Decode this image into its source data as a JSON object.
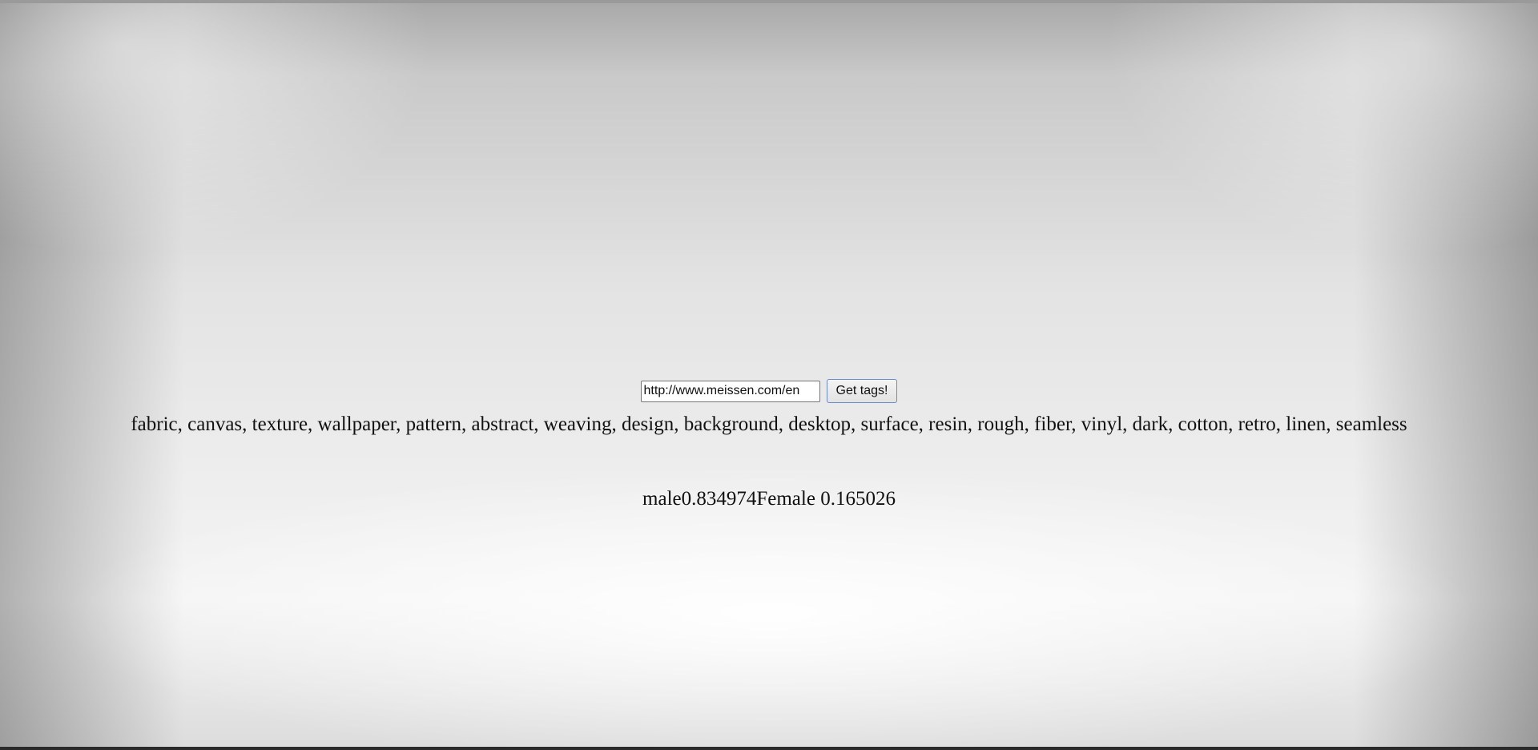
{
  "form": {
    "url_value": "http://www.meissen.com/en",
    "button_label": "Get tags!"
  },
  "result": {
    "tags_text": "fabric, canvas, texture, wallpaper, pattern, abstract, weaving, design, background, desktop, surface, resin, rough, fiber, vinyl, dark, cotton, retro, linen, seamless",
    "gender_text": "male0.834974Female 0.165026"
  }
}
